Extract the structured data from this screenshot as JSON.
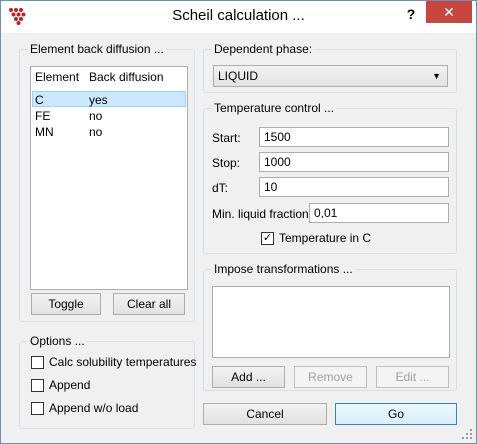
{
  "window": {
    "title": "Scheil calculation ...",
    "help_label": "?",
    "close_label": "✕"
  },
  "element_back_diffusion": {
    "group_label": "Element back diffusion ...",
    "column_element": "Element",
    "column_back_diffusion": "Back diffusion",
    "rows": [
      {
        "element": "C",
        "back_diffusion": "yes",
        "selected": true
      },
      {
        "element": "FE",
        "back_diffusion": "no",
        "selected": false
      },
      {
        "element": "MN",
        "back_diffusion": "no",
        "selected": false
      }
    ],
    "toggle_label": "Toggle",
    "clear_all_label": "Clear all"
  },
  "options": {
    "group_label": "Options ...",
    "items": [
      {
        "label": "Calc solubility temperatures",
        "checked": false
      },
      {
        "label": "Append",
        "checked": false
      },
      {
        "label": "Append w/o load",
        "checked": false
      }
    ]
  },
  "dependent_phase": {
    "group_label": "Dependent phase:",
    "selected": "LIQUID"
  },
  "temperature_control": {
    "group_label": "Temperature control ...",
    "start_label": "Start:",
    "start_value": "1500",
    "stop_label": "Stop:",
    "stop_value": "1000",
    "dt_label": "dT:",
    "dt_value": "10",
    "min_liquid_label": "Min. liquid fraction:",
    "min_liquid_value": "0,01",
    "temp_in_c_label": "Temperature in C",
    "temp_in_c_checked": true
  },
  "impose_transformations": {
    "group_label": "Impose transformations ...",
    "add_label": "Add ...",
    "remove_label": "Remove",
    "edit_label": "Edit ..."
  },
  "dialog_buttons": {
    "cancel_label": "Cancel",
    "go_label": "Go"
  },
  "colors": {
    "accent_close": "#c7463f",
    "selection": "#cce8ff",
    "default_button_border": "#3c7fb1"
  }
}
